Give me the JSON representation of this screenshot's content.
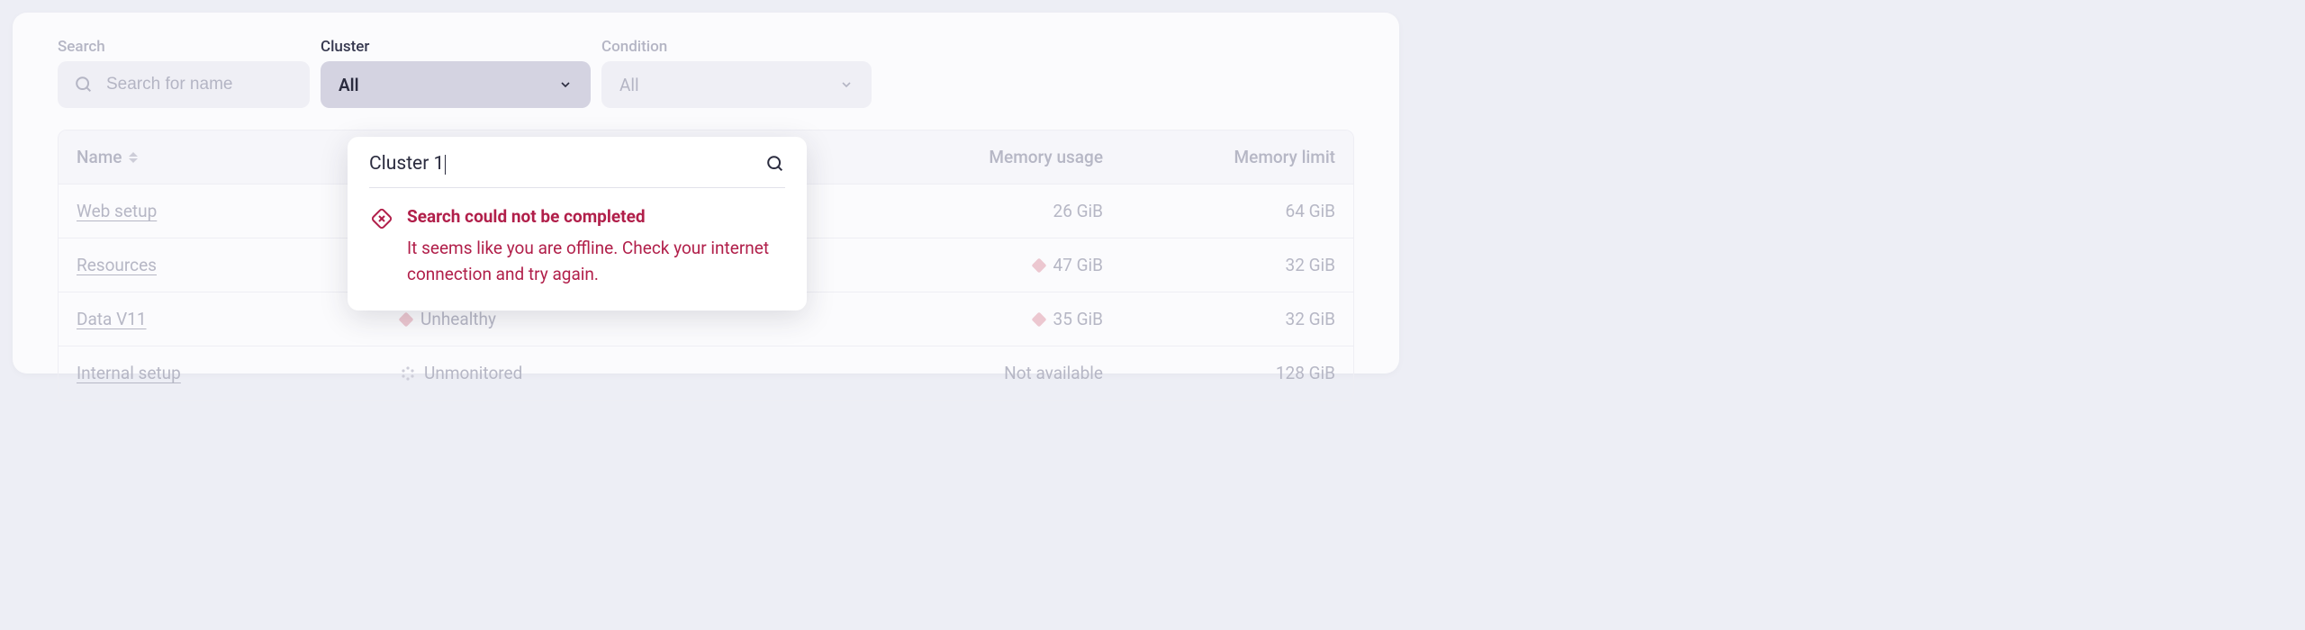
{
  "filters": {
    "search": {
      "label": "Search",
      "placeholder": "Search for name"
    },
    "cluster": {
      "label": "Cluster",
      "value": "All"
    },
    "condition": {
      "label": "Condition",
      "value": "All"
    }
  },
  "columns": {
    "name": "Name",
    "memory_usage": "Memory usage",
    "memory_limit": "Memory limit"
  },
  "rows": [
    {
      "name": "Web setup",
      "status": "",
      "status_icon": "none",
      "usage": "26 GiB",
      "usage_icon": false,
      "limit": "64 GiB"
    },
    {
      "name": "Resources",
      "status": "",
      "status_icon": "none",
      "usage": "47 GiB",
      "usage_icon": true,
      "limit": "32 GiB"
    },
    {
      "name": "Data V11",
      "status": "Unhealthy",
      "status_icon": "diamond",
      "usage": "35 GiB",
      "usage_icon": true,
      "limit": "32 GiB"
    },
    {
      "name": "Internal setup",
      "status": "Unmonitored",
      "status_icon": "dots",
      "usage": "Not available",
      "usage_icon": false,
      "limit": "128 GiB"
    }
  ],
  "popover": {
    "query": "Cluster 1",
    "error_title": "Search could not be completed",
    "error_body": "It seems like you are offline. Check your internet connection and try again."
  }
}
